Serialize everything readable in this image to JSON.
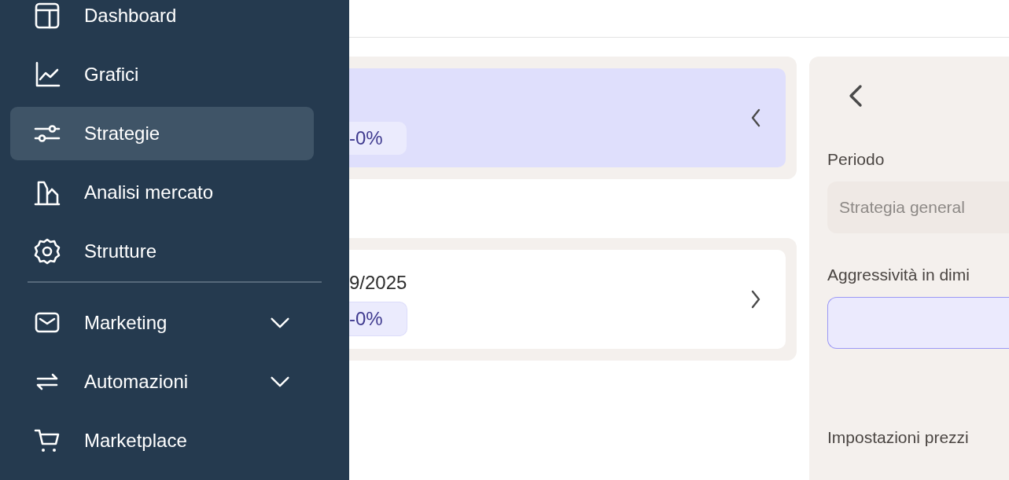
{
  "sidebar": {
    "items": [
      {
        "label": "Dashboard",
        "selected": false
      },
      {
        "label": "Grafici",
        "selected": false
      },
      {
        "label": "Strategie",
        "selected": true
      },
      {
        "label": "Analisi mercato",
        "selected": false
      },
      {
        "label": "Strutture",
        "selected": false
      }
    ],
    "groups": [
      {
        "label": "Marketing",
        "kind": "group",
        "expanded": false
      },
      {
        "label": "Automazioni",
        "kind": "group",
        "expanded": false
      },
      {
        "label": "Marketplace",
        "kind": "link"
      }
    ]
  },
  "strategies": [
    {
      "change": "-0%",
      "selected": true
    },
    {
      "date": "9/2025",
      "change": "-0%",
      "selected": false
    }
  ],
  "detail": {
    "fields": [
      {
        "label": "Periodo",
        "placeholder": "Strategia general",
        "focused": false
      },
      {
        "label": "Aggressività in dimi",
        "focused": true
      }
    ],
    "section_title": "Impostazioni prezzi"
  }
}
